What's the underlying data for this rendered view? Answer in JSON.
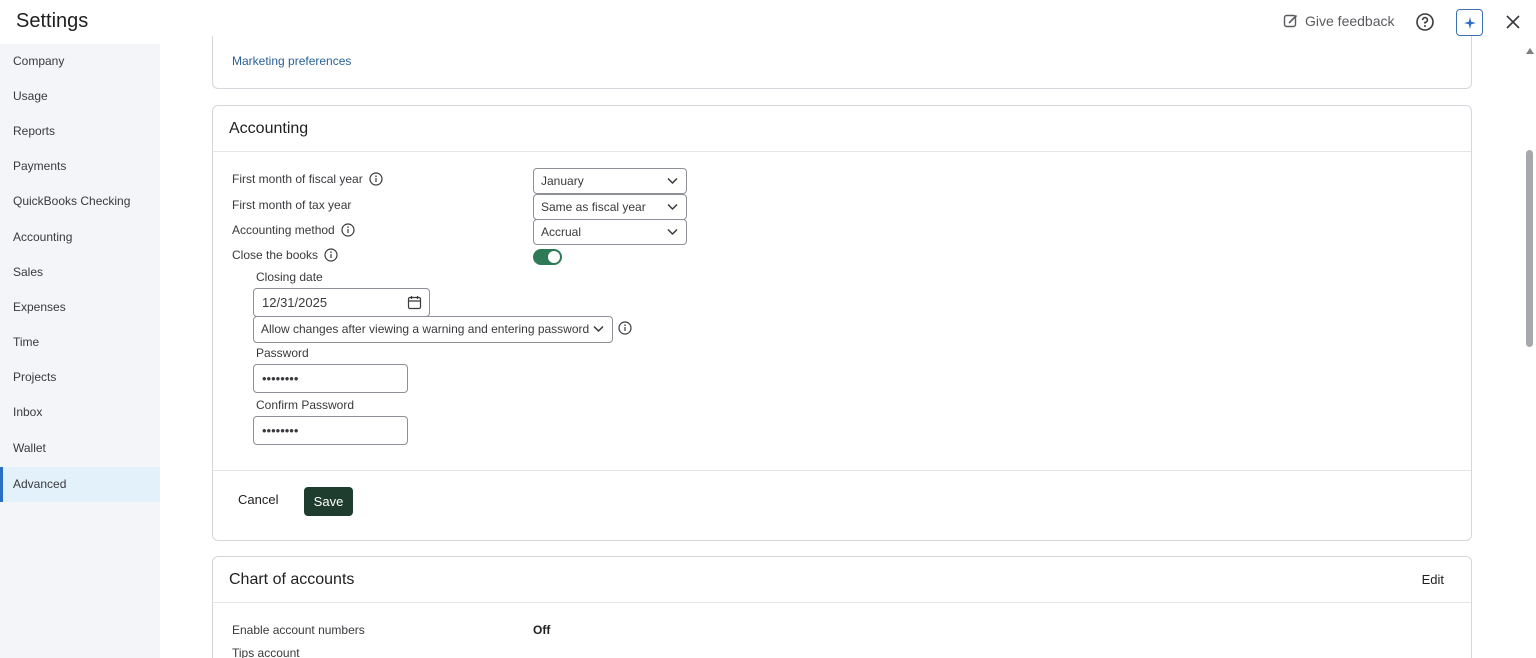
{
  "header": {
    "title": "Settings",
    "give_feedback": "Give feedback"
  },
  "sidebar": {
    "items": [
      {
        "label": "Company"
      },
      {
        "label": "Usage"
      },
      {
        "label": "Reports"
      },
      {
        "label": "Payments"
      },
      {
        "label": "QuickBooks Checking"
      },
      {
        "label": "Accounting"
      },
      {
        "label": "Sales"
      },
      {
        "label": "Expenses"
      },
      {
        "label": "Time"
      },
      {
        "label": "Projects"
      },
      {
        "label": "Inbox"
      },
      {
        "label": "Wallet"
      },
      {
        "label": "Advanced"
      }
    ],
    "active": "Advanced"
  },
  "top_card": {
    "link": "Marketing preferences"
  },
  "accounting": {
    "title": "Accounting",
    "fiscal_label": "First month of fiscal year",
    "fiscal_value": "January",
    "tax_label": "First month of tax year",
    "tax_value": "Same as fiscal year",
    "method_label": "Accounting method",
    "method_value": "Accrual",
    "close_books_label": "Close the books",
    "close_books_on": true,
    "closing_date_label": "Closing date",
    "closing_date_value": "12/31/2025",
    "changes_value": "Allow changes after viewing a warning and entering password",
    "password_label": "Password",
    "password_value": "••••••••",
    "confirm_label": "Confirm Password",
    "confirm_value": "••••••••",
    "cancel": "Cancel",
    "save": "Save"
  },
  "chart_of_accounts": {
    "title": "Chart of accounts",
    "edit": "Edit",
    "account_numbers_label": "Enable account numbers",
    "account_numbers_value": "Off",
    "tips_label": "Tips account"
  },
  "colors": {
    "accent_green": "#1e3d2f",
    "toggle_green": "#2e7a57",
    "link_blue": "#2a6296",
    "sidebar_bg": "#f4f5f8",
    "active_bg": "#e3f1fb"
  }
}
